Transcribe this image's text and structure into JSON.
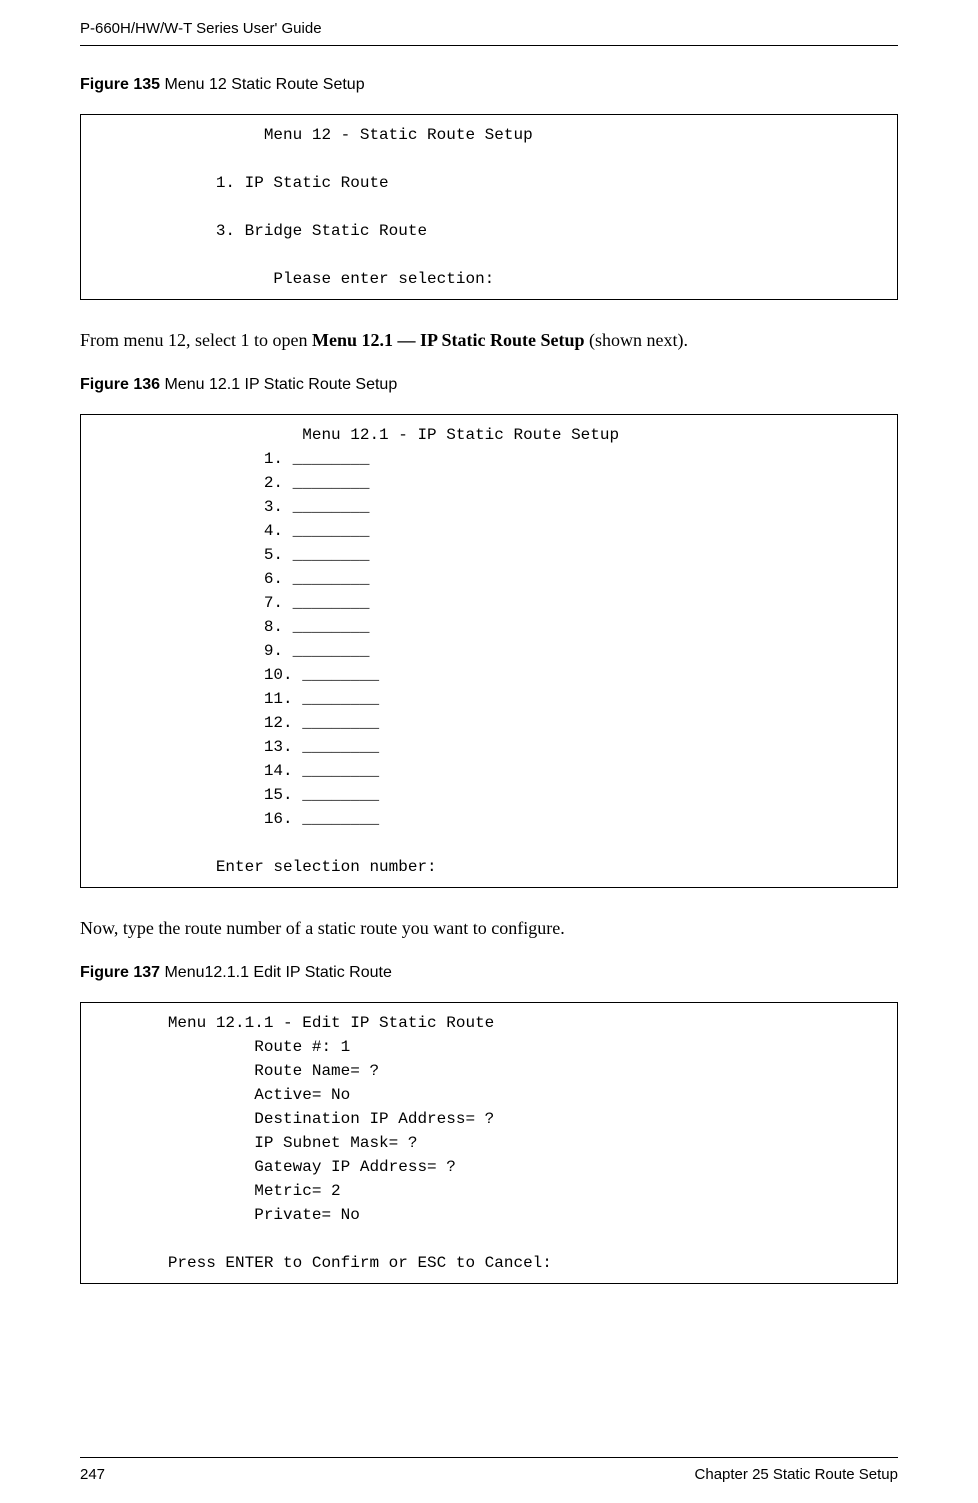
{
  "header": {
    "guide_title": "P-660H/HW/W-T Series User' Guide"
  },
  "figure135": {
    "label_bold": "Figure 135",
    "label_rest": "   Menu 12 Static Route Setup",
    "box_content": "                  Menu 12 - Static Route Setup\n\n             1. IP Static Route\n\n             3. Bridge Static Route\n\n                   Please enter selection:"
  },
  "paragraph1": {
    "before": "From menu 12, select 1 to open ",
    "bold": "Menu 12.1 — IP Static Route Setup",
    "after": " (shown next)."
  },
  "figure136": {
    "label_bold": "Figure 136",
    "label_rest": "   Menu 12.1 IP Static Route Setup",
    "box_content": "                      Menu 12.1 - IP Static Route Setup\n                  1. ________\n                  2. ________\n                  3. ________\n                  4. ________\n                  5. ________\n                  6. ________\n                  7. ________\n                  8. ________\n                  9. ________\n                  10. ________\n                  11. ________\n                  12. ________\n                  13. ________\n                  14. ________\n                  15. ________\n                  16. ________\n\n             Enter selection number:"
  },
  "paragraph2": {
    "text": "Now, type the route number of a static route you want to configure."
  },
  "figure137": {
    "label_bold": "Figure 137",
    "label_rest": "   Menu12.1.1 Edit IP Static Route",
    "box_content": "        Menu 12.1.1 - Edit IP Static Route\n                 Route #: 1\n                 Route Name= ?\n                 Active= No\n                 Destination IP Address= ?\n                 IP Subnet Mask= ?\n                 Gateway IP Address= ?\n                 Metric= 2\n                 Private= No\n\n        Press ENTER to Confirm or ESC to Cancel:"
  },
  "footer": {
    "page_number": "247",
    "chapter": "Chapter 25 Static Route Setup"
  }
}
